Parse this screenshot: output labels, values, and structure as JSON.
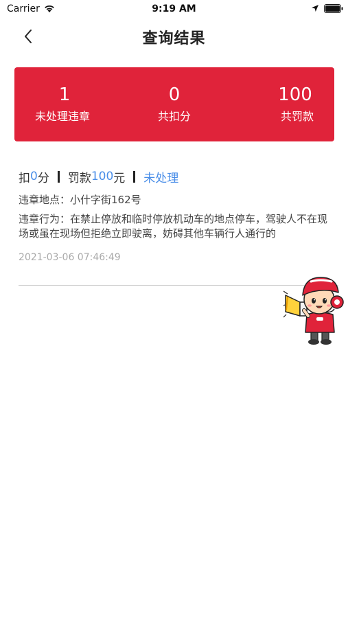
{
  "status_bar": {
    "carrier": "Carrier",
    "time": "9:19 AM",
    "icons": [
      "wifi-icon",
      "location-arrow-icon",
      "battery-icon"
    ]
  },
  "nav": {
    "back_icon": "chevron-left-icon",
    "title": "查询结果"
  },
  "summary": {
    "unprocessed_count": "1",
    "unprocessed_label": "未处理违章",
    "points_total": "0",
    "points_label": "共扣分",
    "fine_total": "100",
    "fine_label": "共罚款",
    "card_color": "#e0233a"
  },
  "record": {
    "points_prefix": "扣",
    "points": "0",
    "points_suffix": "分",
    "fine_prefix": "罚款",
    "fine": "100",
    "fine_suffix": "元",
    "status": "未处理",
    "location_label": "违章地点：",
    "location": "小什字街162号",
    "behavior_label": "违章行为：",
    "behavior": "在禁止停放和临时停放机动车的地点停车，驾驶人不在现场或虽在现场但拒绝立即驶离，妨碍其他车辆行人通行的",
    "time": "2021-03-06 07:46:49",
    "accent_color": "#4a8ee8"
  },
  "mascot": {
    "icon": "megaphone-mascot-icon"
  }
}
